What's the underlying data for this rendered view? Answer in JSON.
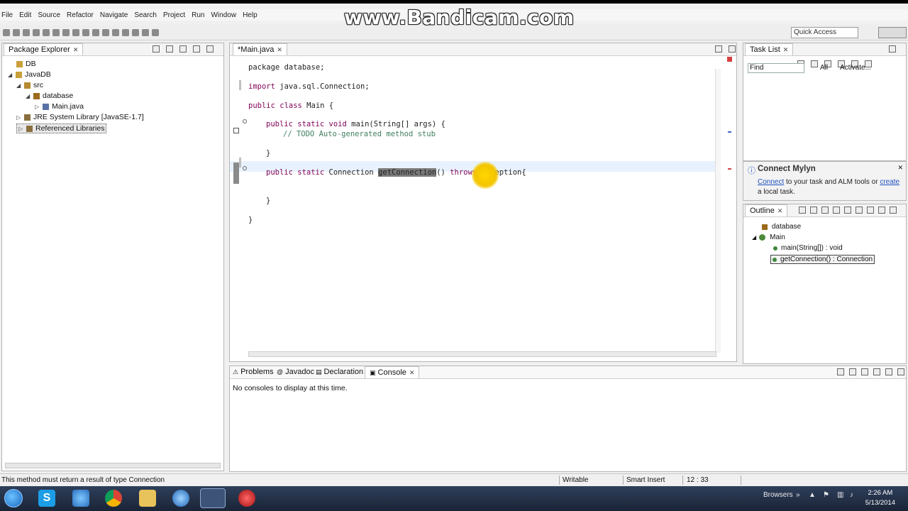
{
  "watermark": "www.Bandicam.com",
  "menu": [
    "File",
    "Edit",
    "Source",
    "Refactor",
    "Navigate",
    "Search",
    "Project",
    "Run",
    "Window",
    "Help"
  ],
  "toolbar": {
    "quick_access": "Quick Access"
  },
  "package_explorer": {
    "tab_label": "Package Explorer",
    "items": [
      {
        "label": "DB",
        "depth": 0
      },
      {
        "label": "JavaDB",
        "depth": 0
      },
      {
        "label": "src",
        "depth": 1
      },
      {
        "label": "database",
        "depth": 2
      },
      {
        "label": "Main.java",
        "depth": 3
      },
      {
        "label": "JRE System Library [JavaSE-1.7]",
        "depth": 1
      },
      {
        "label": "Referenced Libraries",
        "depth": 1
      }
    ]
  },
  "editor": {
    "tab_label": "*Main.java",
    "lines": {
      "l1": "package database;",
      "l2_kw": "import",
      "l2": " java.sql.Connection;",
      "l3_kw": "public class",
      "l3": " Main {",
      "l4_kw": "public static void",
      "l4": " main(String[] args) {",
      "l5": "// TODO Auto-generated method stub",
      "l6": "}",
      "l7_kw": "public static",
      "l7_a": " Connection ",
      "l7_sel": "getConnection",
      "l7_b": "() ",
      "l7_kw2": "throws",
      "l7_c": " Exception{",
      "l8": "}",
      "l9": "}"
    }
  },
  "task_list": {
    "tab_label": "Task List",
    "find_placeholder": "Find",
    "all": "All",
    "activate": "Activate..."
  },
  "mylyn": {
    "title": "Connect Mylyn",
    "connect_link": "Connect",
    "text_mid": " to your task and ALM tools or ",
    "create_link": "create",
    "text_end": "a local task."
  },
  "outline": {
    "tab_label": "Outline",
    "items": [
      "database",
      "Main",
      "main(String[]) : void",
      "getConnection() : Connection"
    ]
  },
  "bottom_tabs": {
    "problems": "Problems",
    "javadoc": "Javadoc",
    "declaration": "Declaration",
    "console": "Console",
    "message": "No consoles to display at this time."
  },
  "status": {
    "message": "This method must return a result of type Connection",
    "writable": "Writable",
    "insert_mode": "Smart Insert",
    "position": "12 : 33"
  },
  "taskbar": {
    "tray_label": "Browsers",
    "time": "2:26 AM",
    "date": "5/13/2014",
    "apps": [
      "skype-icon",
      "network-icon",
      "chrome-icon",
      "folder-icon",
      "globe-icon",
      "eclipse-icon",
      "app-red-icon"
    ]
  }
}
